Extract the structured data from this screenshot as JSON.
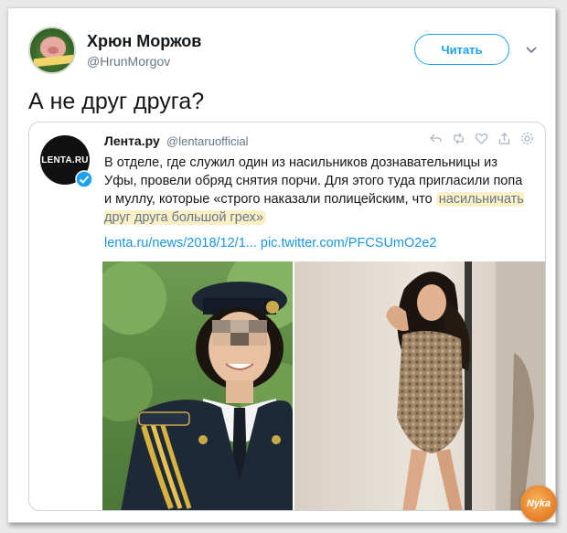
{
  "author": {
    "display_name": "Хрюн Моржов",
    "handle": "@HrunMorgov"
  },
  "follow_button": {
    "label": "Читать"
  },
  "tweet": {
    "text": "А не друг друга?"
  },
  "quoted": {
    "avatar_label": "LENTA.RU",
    "name": "Лента.ру",
    "handle": "@lentaruofficial",
    "body_part1": "В отделе, где служил один из насильников дознавательницы из Уфы, провели обряд снятия порчи. Для этого туда пригласили попа и муллу, которые «строго наказали полицейским, что ",
    "body_highlight": "насильничать друг друга большой грех»",
    "link": "lenta.ru/news/2018/12/1... pic.twitter.com/PFCSUmO2e2"
  },
  "watermark": {
    "label": "Nyka"
  },
  "colors": {
    "accent": "#1da1f2",
    "link": "#1b95e0",
    "highlight": "#fbefc6"
  }
}
